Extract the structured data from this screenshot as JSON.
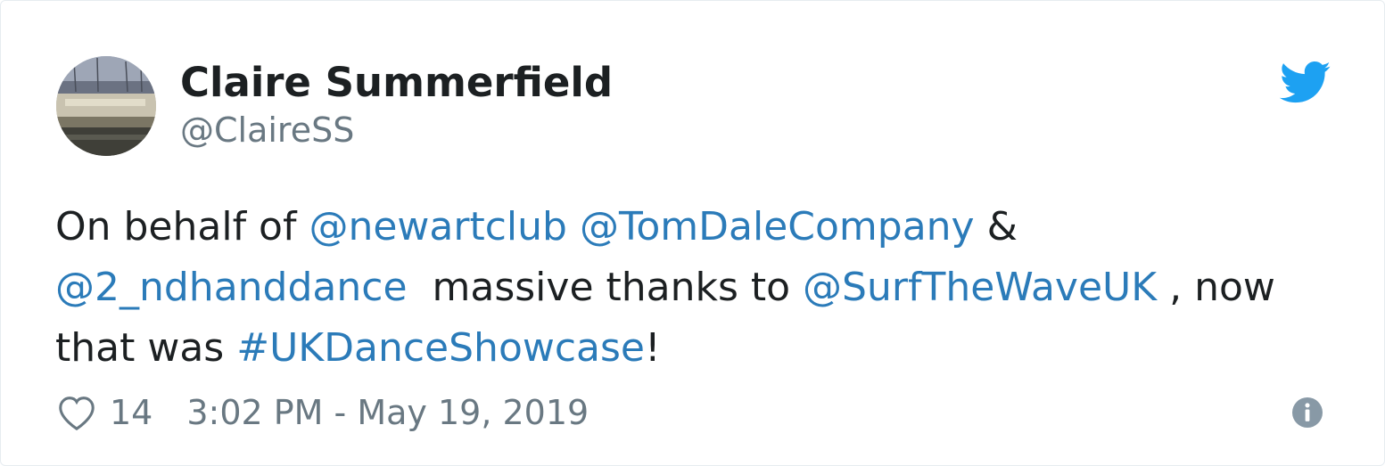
{
  "tweet": {
    "author": {
      "display_name": "Claire Summerfield",
      "handle": "@ClaireSS"
    },
    "text": {
      "seg1": "On behalf of ",
      "mention1": "@newartclub",
      "seg2": " ",
      "mention2": "@TomDaleCompany",
      "seg3": " & ",
      "mention3": "@2_ndhanddance",
      "seg4": "  massive thanks to ",
      "mention4": "@SurfTheWaveUK",
      "seg5": " , now that was ",
      "hashtag1": "#UKDanceShowcase",
      "seg6": "!"
    },
    "likes": "14",
    "timestamp": "3:02 PM - May 19, 2019"
  },
  "icons": {
    "brand": "twitter-bird-icon",
    "like": "heart-icon",
    "info": "info-icon"
  },
  "colors": {
    "link": "#2b7bb9",
    "twitter_blue": "#1da1f2",
    "text": "#1c2022",
    "muted": "#697882"
  }
}
